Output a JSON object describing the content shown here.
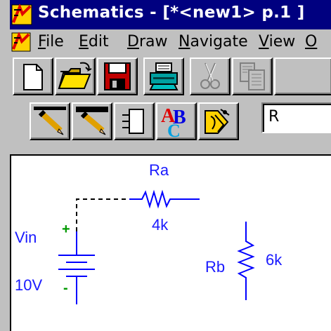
{
  "window": {
    "title": "Schematics - [*<new1>  p.1  ]"
  },
  "menu": {
    "items": [
      {
        "underline": "F",
        "rest": "ile"
      },
      {
        "underline": "E",
        "rest": "dit"
      },
      {
        "underline": "D",
        "rest": "raw"
      },
      {
        "underline": "N",
        "rest": "avigate"
      },
      {
        "underline": "V",
        "rest": "iew"
      },
      {
        "underline": "O",
        "rest": ""
      }
    ]
  },
  "toolbar": {
    "part_field_value": "R"
  },
  "schematic": {
    "ra_name": "Ra",
    "ra_value": "4k",
    "rb_name": "Rb",
    "rb_value": "6k",
    "vin_name": "Vin",
    "vin_value": "10V",
    "plus_sign": "+",
    "minus_sign": "-"
  },
  "colors": {
    "titlebar": "#000080",
    "wire": "#0000ff",
    "pin_mark": "#009900"
  }
}
